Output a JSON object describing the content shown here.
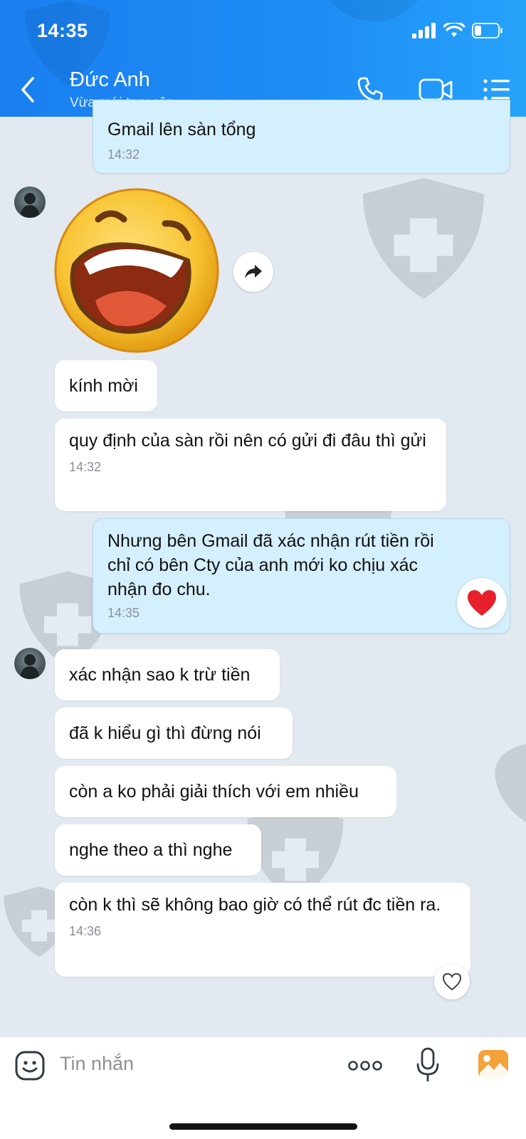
{
  "status_bar": {
    "time": "14:35"
  },
  "header": {
    "contact_name": "Đức Anh",
    "contact_status": "Vừa mới truy cập"
  },
  "messages": [
    {
      "id": "m1",
      "sender": "me",
      "text": "Gmail lên sàn tổng",
      "time": "14:32"
    },
    {
      "id": "m2",
      "sender": "contact",
      "type": "sticker",
      "sticker": "laughing-face-sticker"
    },
    {
      "id": "m3",
      "sender": "contact",
      "text": "kính mời"
    },
    {
      "id": "m4",
      "sender": "contact",
      "text": "quy định của sàn rồi nên có gửi đi đâu thì gửi",
      "time": "14:32"
    },
    {
      "id": "m5",
      "sender": "me",
      "text": "Nhưng bên Gmail đã xác nhận rút tiền rồi chỉ có bên Cty của anh mới ko chịu xác nhận đo chu.",
      "time": "14:35",
      "reaction": "heart-filled"
    },
    {
      "id": "m6",
      "sender": "contact",
      "text": "xác nhận sao k trừ tiền"
    },
    {
      "id": "m7",
      "sender": "contact",
      "text": "đã k hiểu gì thì đừng nói"
    },
    {
      "id": "m8",
      "sender": "contact",
      "text": "còn a ko phải giải thích với em nhiều"
    },
    {
      "id": "m9",
      "sender": "contact",
      "text": "nghe theo a thì nghe"
    },
    {
      "id": "m10",
      "sender": "contact",
      "text": "còn k thì sẽ không bao giờ có thể rút đc tiền ra.",
      "time": "14:36",
      "reaction": "heart-outline"
    }
  ],
  "composer": {
    "placeholder": "Tin nhắn"
  },
  "colors": {
    "header_blue": "#1e8df5",
    "sent_bubble": "#d5f0fd",
    "received_bubble": "#ffffff",
    "chat_background": "#e2e9f1",
    "heart_red": "#e8202b"
  }
}
